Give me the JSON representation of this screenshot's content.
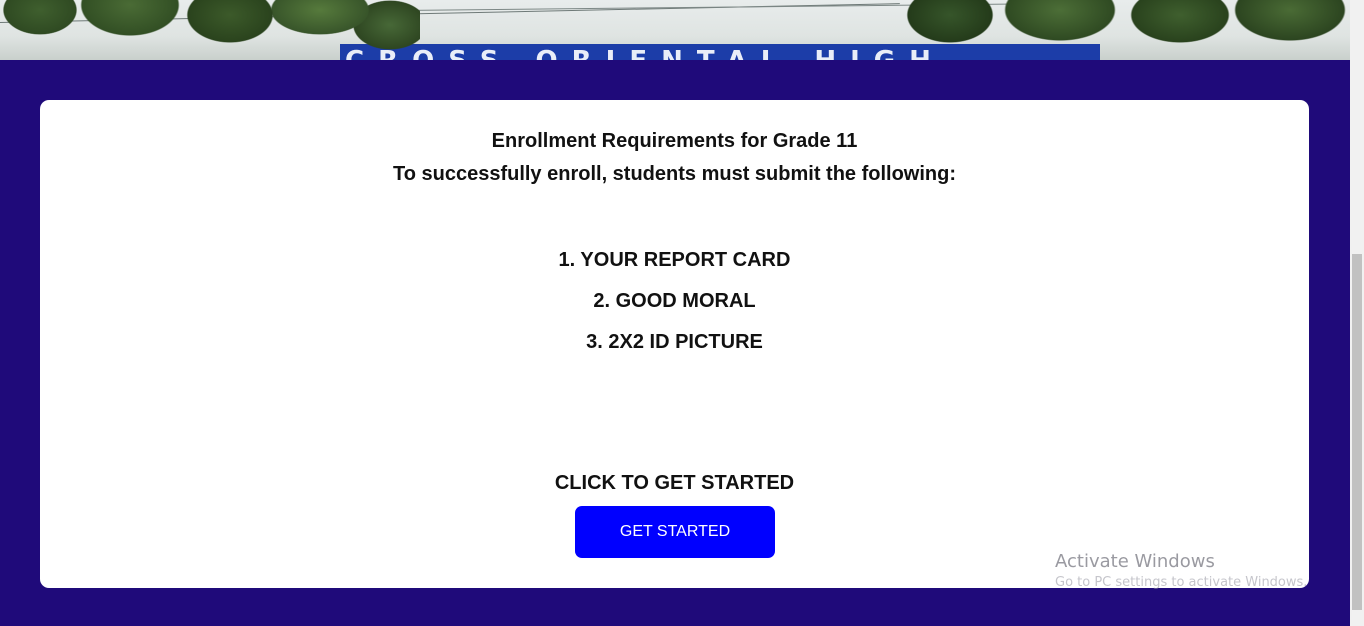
{
  "banner": {
    "sign_text": "CROSS ORIENTAL HIGH"
  },
  "card": {
    "heading_1": "Enrollment Requirements for Grade 11",
    "heading_2": "To successfully enroll, students must submit the following:",
    "requirements": [
      "1. YOUR REPORT CARD",
      "2. GOOD MORAL",
      "3. 2X2 ID PICTURE"
    ],
    "cta_label": "CLICK TO GET STARTED",
    "button_label": "GET STARTED"
  },
  "watermark": {
    "title": "Activate Windows",
    "subtitle": "Go to PC settings to activate Windows."
  },
  "colors": {
    "background": "#1f0a7a",
    "card": "#ffffff",
    "button": "#0000ff",
    "button_text": "#ffffff"
  }
}
